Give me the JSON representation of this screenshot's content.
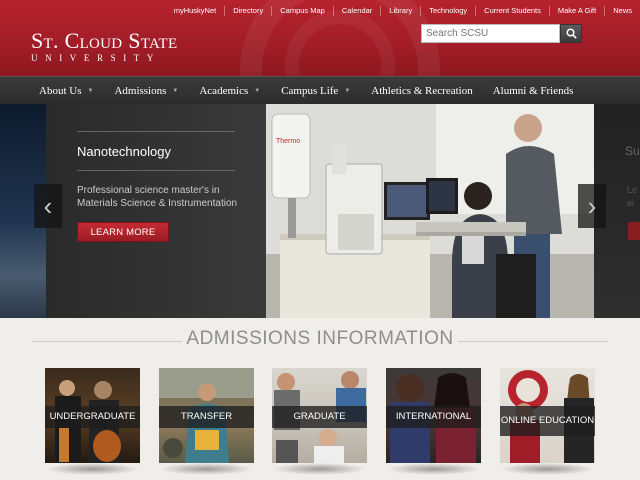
{
  "top_links": [
    "myHuskyNet",
    "Directory",
    "Campus Map",
    "Calendar",
    "Library",
    "Technology",
    "Current Students",
    "Make A Gift",
    "News"
  ],
  "logo": {
    "name": "St. Cloud State",
    "sub": "UNIVERSITY"
  },
  "search": {
    "placeholder": "Search SCSU"
  },
  "nav": [
    {
      "label": "About Us"
    },
    {
      "label": "Admissions"
    },
    {
      "label": "Academics"
    },
    {
      "label": "Campus Life"
    },
    {
      "label": "Athletics & Recreation"
    },
    {
      "label": "Alumni & Friends"
    }
  ],
  "hero": {
    "title": "Nanotechnology",
    "description": "Professional science master's in Materials Science & Instrumentation",
    "button": "LEARN MORE",
    "next_slide_title": "Su",
    "next_slide_text": "Le\nei",
    "photo_brand": "Thermo"
  },
  "admissions": {
    "title": "ADMISSIONS INFORMATION",
    "tiles": [
      {
        "label": "UNDERGRADUATE"
      },
      {
        "label": "TRANSFER"
      },
      {
        "label": "GRADUATE"
      },
      {
        "label": "INTERNATIONAL"
      },
      {
        "label": "ONLINE EDUCATION"
      }
    ]
  },
  "colors": {
    "brand_red": "#a11d27",
    "nav_dark": "#2f2f2f",
    "button_red": "#b02530"
  }
}
